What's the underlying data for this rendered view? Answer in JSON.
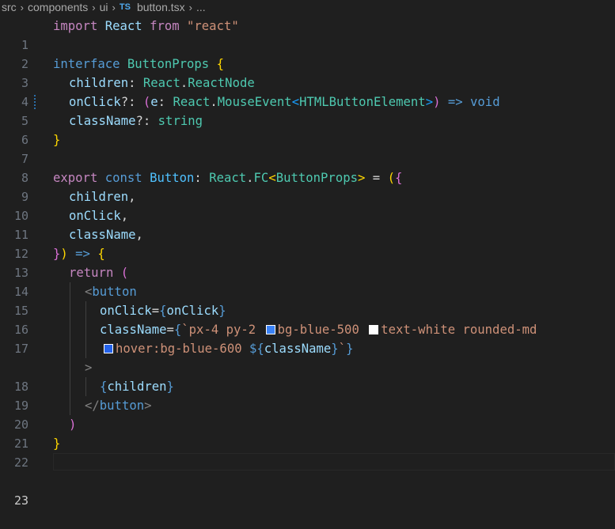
{
  "breadcrumb": {
    "items": [
      "src",
      "components",
      "ui"
    ],
    "file_icon": "TS",
    "file": "button.tsx",
    "more": "..."
  },
  "colors": {
    "swatch_bg_blue_500": "#3b82f6",
    "swatch_text_white": "#ffffff",
    "swatch_bg_blue_600": "#2563eb"
  },
  "editor": {
    "line_numbers": [
      "1",
      "2",
      "3",
      "4",
      "5",
      "6",
      "7",
      "8",
      "9",
      "10",
      "11",
      "12",
      "13",
      "14",
      "15",
      "16",
      "17",
      "",
      "18",
      "19",
      "20",
      "21",
      "22",
      "23"
    ],
    "active_line": "23",
    "tokens": {
      "l1": [
        "import",
        " React ",
        "from",
        " \"react\""
      ],
      "l3": [
        "interface",
        " ",
        "ButtonProps",
        " ",
        "{"
      ],
      "l4": [
        "children",
        ": ",
        "React",
        ".",
        "ReactNode"
      ],
      "l5": [
        "onClick",
        "?: ",
        "(",
        "e",
        ": ",
        "React",
        ".",
        "MouseEvent",
        "<",
        "HTMLButtonElement",
        ">",
        ")",
        " => ",
        "void"
      ],
      "l6": [
        "className",
        "?: ",
        "string"
      ],
      "l7": [
        "}"
      ],
      "l9": [
        "export",
        " ",
        "const",
        " ",
        "Button",
        ": ",
        "React",
        ".",
        "FC",
        "<",
        "ButtonProps",
        ">",
        " = ",
        "(",
        "{"
      ],
      "l10": [
        "children",
        ","
      ],
      "l11": [
        "onClick",
        ","
      ],
      "l12": [
        "className",
        ","
      ],
      "l13": [
        "}",
        ")",
        " => ",
        "{"
      ],
      "l14": [
        "return",
        " ",
        "("
      ],
      "l15": [
        "<",
        "button"
      ],
      "l16": [
        "onClick",
        "=",
        "{",
        "onClick",
        "}"
      ],
      "l17": [
        "className",
        "=",
        "{",
        "`px-4 py-2 ",
        "bg-blue-500 ",
        "text-white rounded-md"
      ],
      "l17b": [
        "hover:bg-blue-600 ",
        "${",
        "className",
        "}",
        "`",
        "}"
      ],
      "l18": [
        ">"
      ],
      "l19": [
        "{",
        "children",
        "}"
      ],
      "l20": [
        "</",
        "button",
        ">"
      ],
      "l21": [
        ")"
      ],
      "l22": [
        "}"
      ]
    }
  }
}
